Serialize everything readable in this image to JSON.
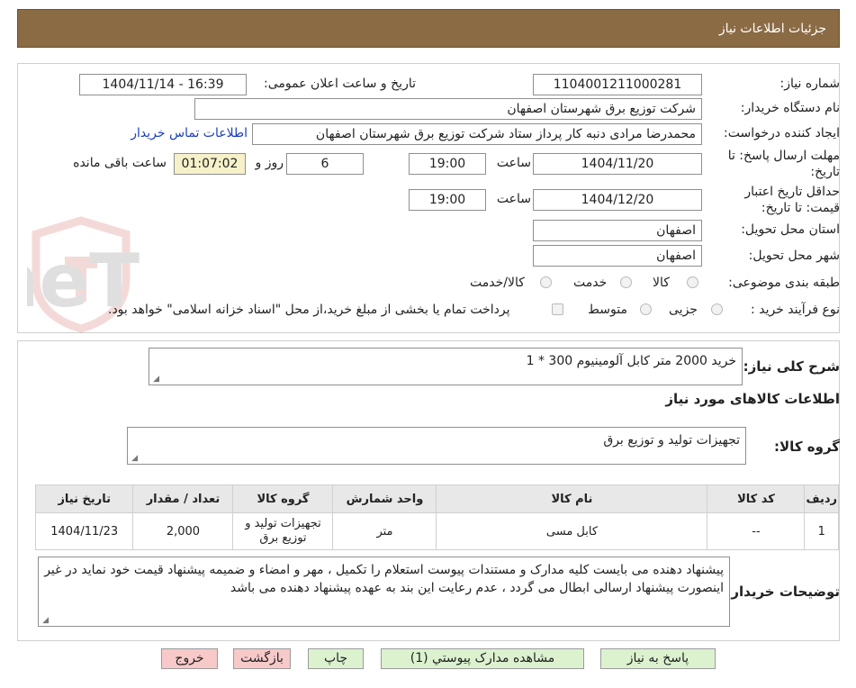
{
  "header": {
    "title": "جزئیات اطلاعات نیاز"
  },
  "form": {
    "need_number_label": "شماره نیاز:",
    "need_number": "1104001211000281",
    "announce_label": "تاریخ و ساعت اعلان عمومی:",
    "announce_value": "1404/11/14 - 16:39",
    "buyer_org_label": "نام دستگاه خریدار:",
    "buyer_org": "شرکت توزیع برق شهرستان اصفهان",
    "creator_label": "ایجاد کننده درخواست:",
    "creator": "محمدرضا مرادی دنبه کار پرداز ستاد شرکت توزیع برق شهرستان اصفهان",
    "contact_link": "اطلاعات تماس خریدار",
    "deadline_label_1": "مهلت ارسال پاسخ: تا",
    "deadline_label_2": "تاریخ:",
    "deadline_date": "1404/11/20",
    "time_label": "ساعت",
    "deadline_time": "19:00",
    "days_value": "6",
    "days_label": "روز و",
    "remaining_time": "01:07:02",
    "remaining_label": "ساعت باقی مانده",
    "validity_label_1": "حداقل تاریخ اعتبار",
    "validity_label_2": "قیمت: تا تاریخ:",
    "validity_date": "1404/12/20",
    "validity_time": "19:00",
    "province_label": "استان محل تحویل:",
    "province": "اصفهان",
    "city_label": "شهر محل تحویل:",
    "city": "اصفهان",
    "category_label": "طبقه بندی موضوعی:",
    "category_options": [
      "کالا",
      "خدمت",
      "کالا/خدمت"
    ],
    "process_label": "نوع فرآیند خرید :",
    "process_options": [
      "جزیی",
      "متوسط"
    ],
    "treasury_text": "پرداخت تمام یا بخشی از مبلغ خرید،از محل \"اسناد خزانه اسلامی\" خواهد بود."
  },
  "watermark": {
    "text": "AriaTender.neT"
  },
  "details": {
    "summary_label": "شرح کلی نیاز:",
    "summary": "خرید 2000 متر کابل آلومینیوم 300 * 1",
    "goods_info_title": "اطلاعات کالاهای مورد نیاز",
    "goods_group_label": "گروه کالا:",
    "goods_group": "تجهیزات تولید و توزیع برق",
    "table": {
      "headers": [
        "ردیف",
        "کد کالا",
        "نام کالا",
        "واحد شمارش",
        "گروه کالا",
        "تعداد / مقدار",
        "تاریخ نیاز"
      ],
      "rows": [
        [
          "1",
          "--",
          "کابل مسی",
          "متر",
          "تجهیزات تولید و توزیع برق",
          "2,000",
          "1404/11/23"
        ]
      ]
    },
    "buyer_notes_label": "توضیحات خریدار:",
    "buyer_notes": "پیشنهاد دهنده می بایست کلیه مدارک و مستندات پیوست استعلام را تکمیل ، مهر و امضاء و ضمیمه پیشنهاد قیمت خود نماید در غیر اینصورت پیشنهاد ارسالی ابطال می گردد ، عدم رعایت این بند به عهده پیشنهاد دهنده می باشد"
  },
  "buttons": {
    "reply": "پاسخ به نیاز",
    "attachments": "مشاهده مدارک پیوستي (1)",
    "print": "چاپ",
    "back": "بازگشت",
    "exit": "خروج"
  },
  "colors": {
    "header_bg": "#8b6b44",
    "link": "#1a3fbf",
    "button_green": "#dcf2cf",
    "button_pink": "#f7c9c9",
    "highlight": "#f6f1c9"
  }
}
